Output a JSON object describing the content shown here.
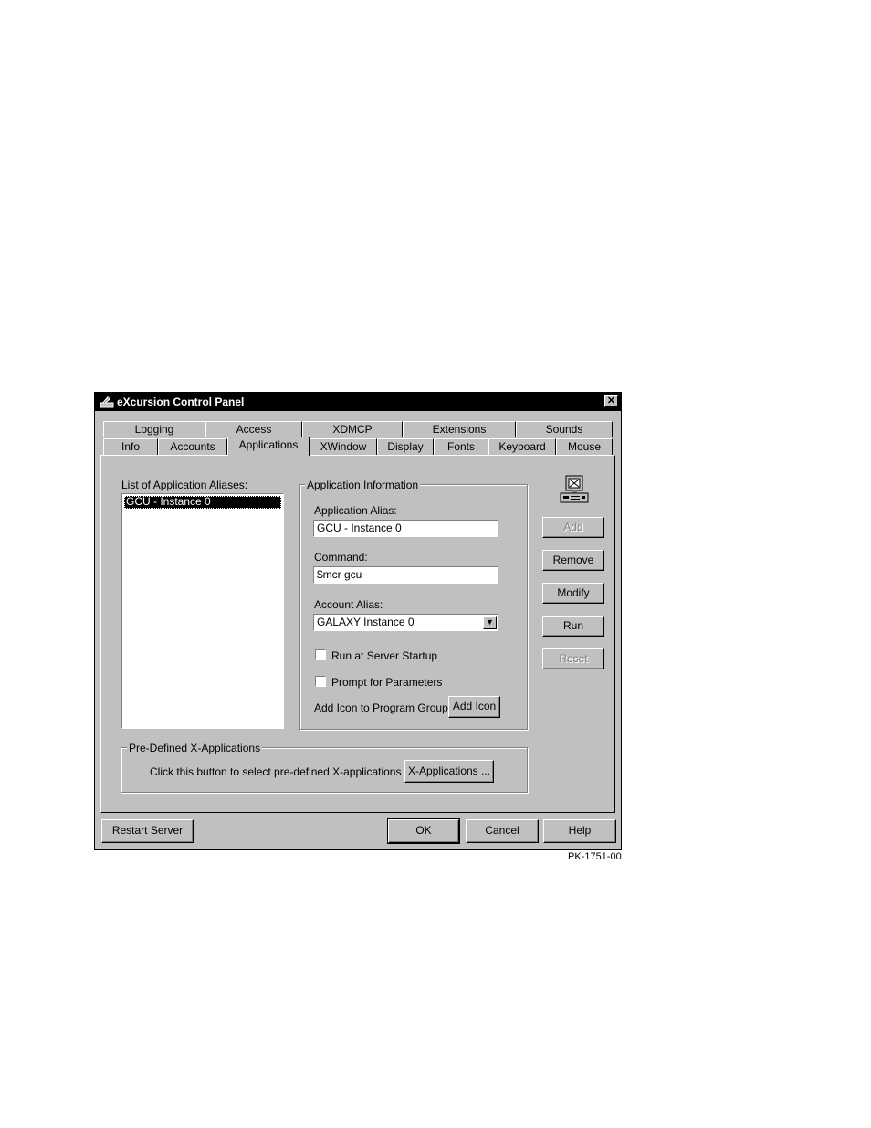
{
  "window": {
    "title": "eXcursion Control Panel",
    "close_glyph": "✕"
  },
  "tabs": {
    "row_back": [
      "Logging",
      "Access",
      "XDMCP",
      "Extensions",
      "Sounds"
    ],
    "row_front": [
      "Info",
      "Accounts",
      "Applications",
      "XWindow",
      "Display",
      "Fonts",
      "Keyboard",
      "Mouse"
    ],
    "active": "Applications"
  },
  "list": {
    "label": "List of Application Aliases:",
    "items": [
      "GCU - Instance 0"
    ],
    "selected": "GCU - Instance 0"
  },
  "app_info": {
    "group_title": "Application Information",
    "alias_label": "Application Alias:",
    "alias_value": "GCU - Instance 0",
    "command_label": "Command:",
    "command_value": "$mcr gcu",
    "account_label": "Account Alias:",
    "account_value": "GALAXY Instance 0",
    "run_startup_label": "Run at Server Startup",
    "run_startup_checked": false,
    "prompt_label": "Prompt for Parameters",
    "prompt_checked": false,
    "add_icon_label": "Add Icon to Program Group",
    "add_icon_button": "Add Icon"
  },
  "side_buttons": {
    "icon": "computer-icon",
    "add": "Add",
    "remove": "Remove",
    "modify": "Modify",
    "run": "Run",
    "reset": "Reset"
  },
  "predefined": {
    "group_title": "Pre-Defined X-Applications",
    "description": "Click this button to select pre-defined X-applications",
    "button": "X-Applications ..."
  },
  "bottom_buttons": {
    "restart": "Restart Server",
    "ok": "OK",
    "cancel": "Cancel",
    "help": "Help"
  },
  "figure_label": "PK-1751-00"
}
